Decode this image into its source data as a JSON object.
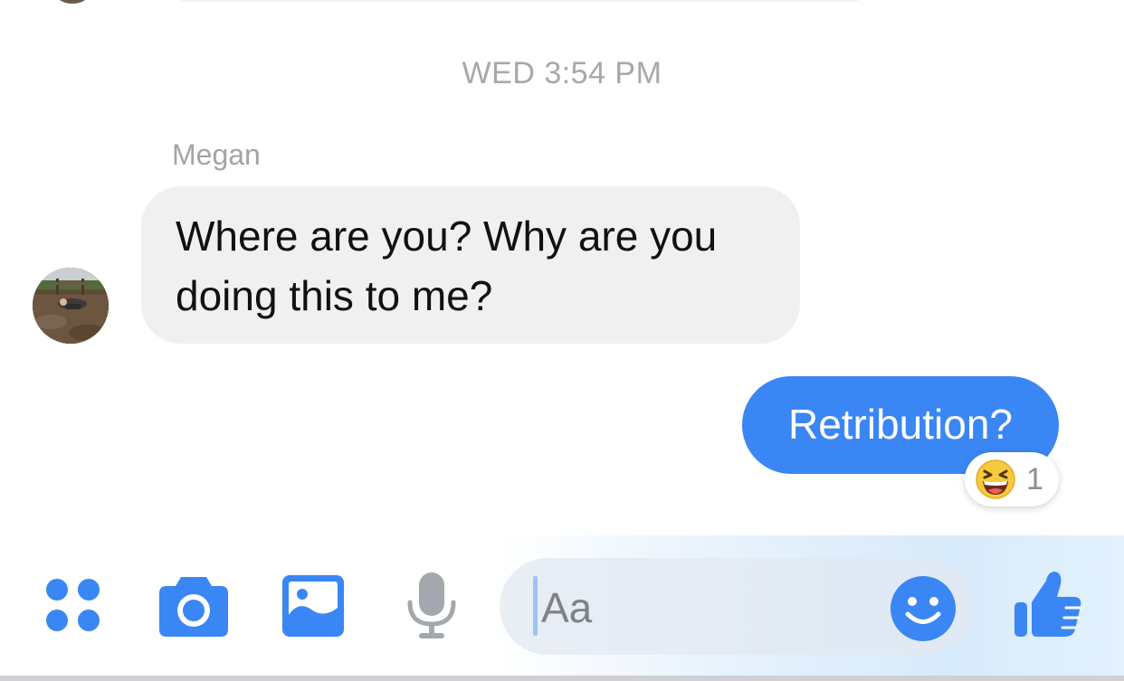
{
  "conversation": {
    "timestamp": "WED 3:54 PM",
    "incoming": {
      "sender": "Megan",
      "text": "Where are you? Why are you doing this to me?"
    },
    "outgoing": {
      "text": "Retribution?",
      "reaction": {
        "emoji": "laughing-face",
        "count": "1"
      }
    }
  },
  "composer": {
    "placeholder": "Aa",
    "tools": [
      "apps-icon",
      "camera-icon",
      "photo-gallery-icon",
      "microphone-icon"
    ],
    "emoji_button": "smiley-icon",
    "send_button": "thumbs-up-icon"
  },
  "colors": {
    "accent": "#3a86f4",
    "incoming_bubble": "#f0f0f0",
    "meta_text": "#a8a8a8",
    "mic_gray": "#a3a8ae"
  }
}
